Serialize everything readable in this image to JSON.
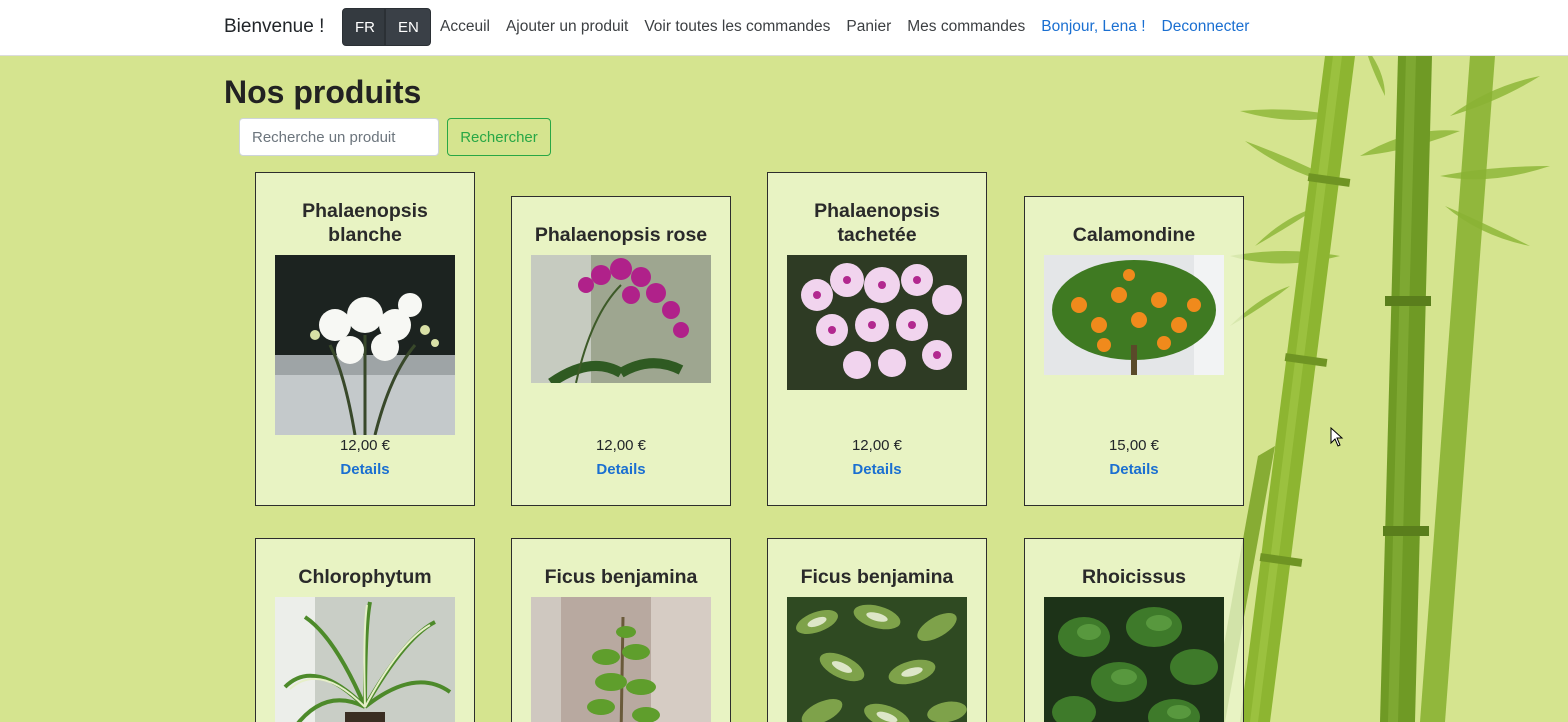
{
  "navbar": {
    "brand": "Bienvenue !",
    "lang_fr": "FR",
    "lang_en": "EN",
    "links": {
      "home": "Acceuil",
      "add_product": "Ajouter un produit",
      "all_orders": "Voir toutes les commandes",
      "cart": "Panier",
      "my_orders": "Mes commandes",
      "greeting": "Bonjour, Lena !",
      "logout": "Deconnecter"
    }
  },
  "page": {
    "title": "Nos produits",
    "search_placeholder": "Recherche un produit",
    "search_button": "Rechercher"
  },
  "products": [
    {
      "name": "Phalaenopsis blanche",
      "price": "12,00 €",
      "details": "Details"
    },
    {
      "name": "Phalaenopsis rose",
      "price": "12,00 €",
      "details": "Details"
    },
    {
      "name": "Phalaenopsis tachetée",
      "price": "12,00 €",
      "details": "Details"
    },
    {
      "name": "Calamondine",
      "price": "15,00 €",
      "details": "Details"
    },
    {
      "name": "Chlorophytum"
    },
    {
      "name": "Ficus benjamina"
    },
    {
      "name": "Ficus benjamina"
    },
    {
      "name": "Rhoicissus"
    }
  ],
  "colors": {
    "page_background": "#d5e48f",
    "card_background": "#eef5d0",
    "link_blue": "#1a6fd1",
    "search_green": "#28a745",
    "dark_button": "#343a40"
  }
}
